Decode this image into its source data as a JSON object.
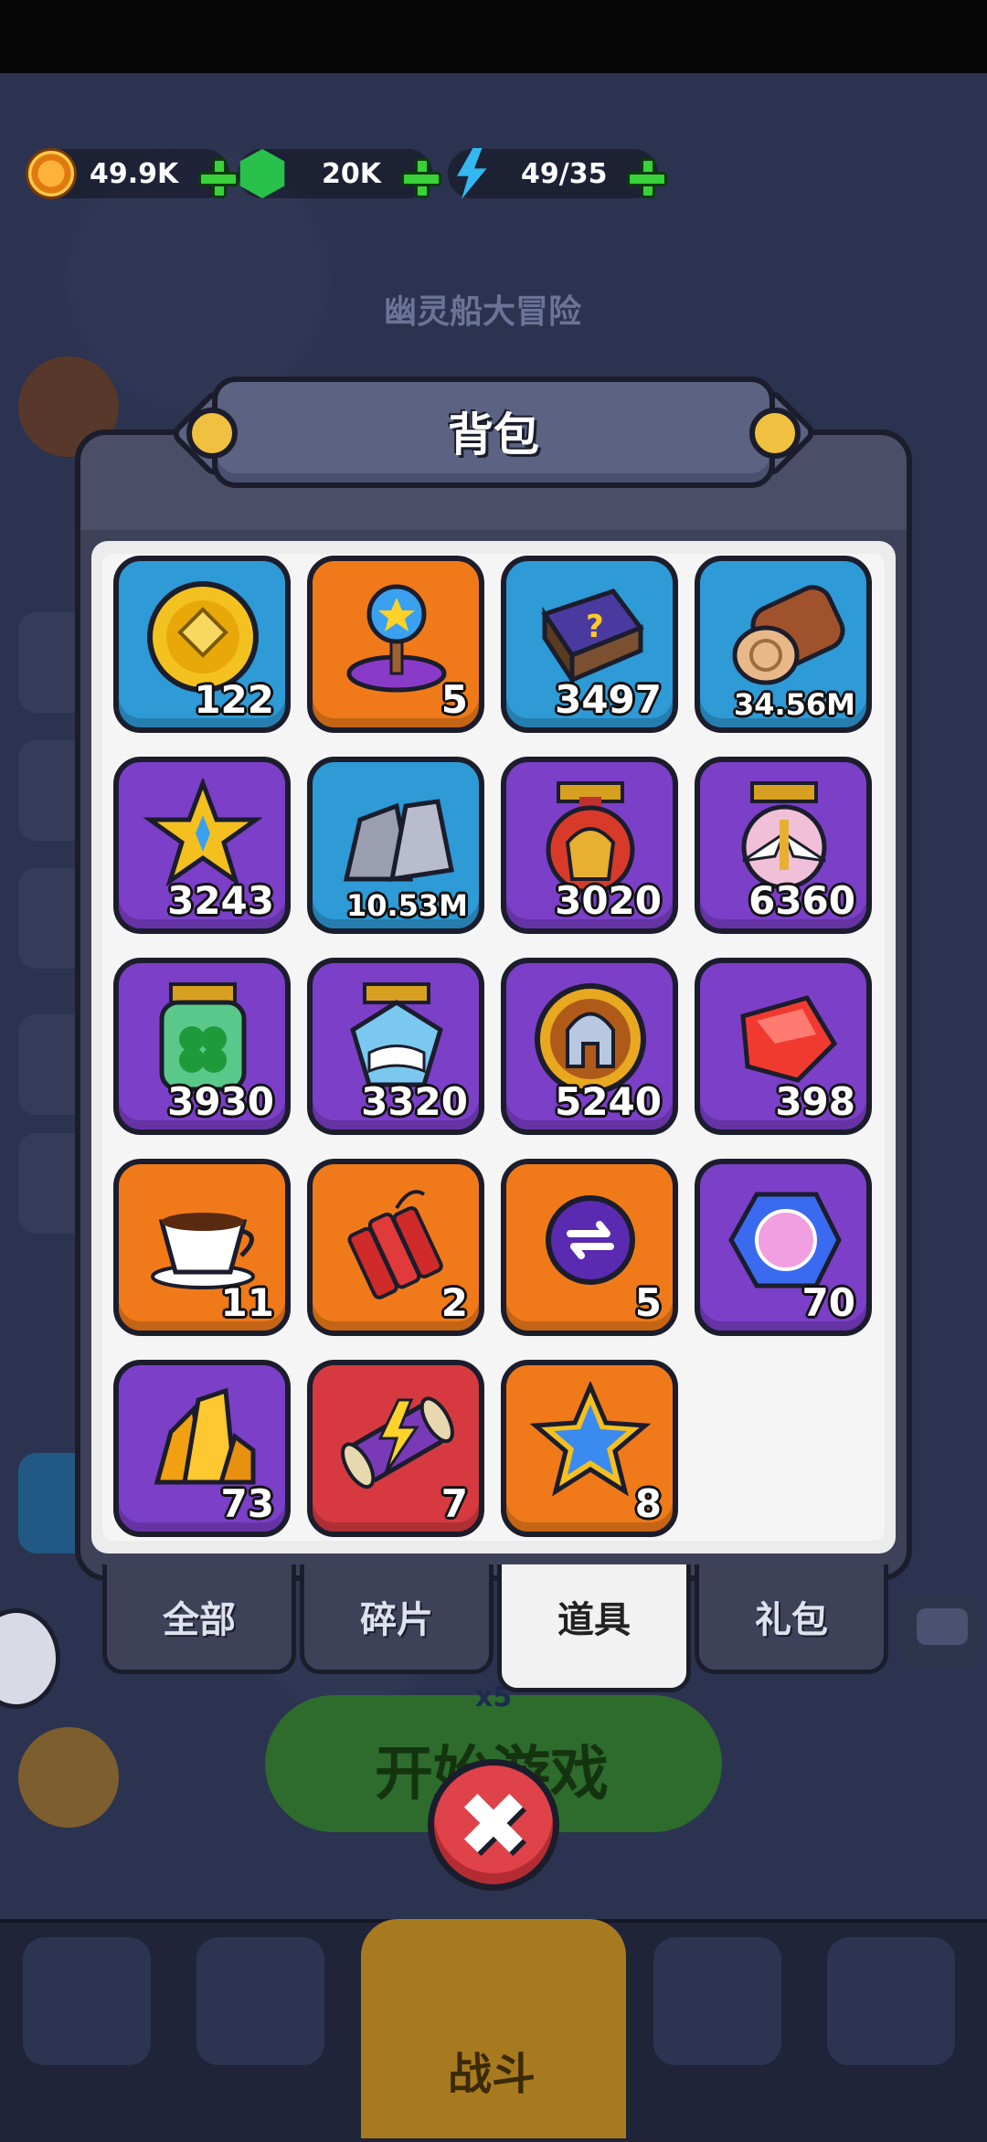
{
  "currency": {
    "gold": "49.9K",
    "gems": "20K",
    "energy": "49/35"
  },
  "background": {
    "event_title": "幽灵船大冒险",
    "start_button": "开始游戏",
    "energy_cost": "x5",
    "nav_fight": "战斗"
  },
  "modal": {
    "title": "背包",
    "items": [
      {
        "name": "gold-token",
        "count": "122",
        "color": "blue"
      },
      {
        "name": "star-pin",
        "count": "5",
        "color": "orange"
      },
      {
        "name": "mystery-book",
        "count": "3497",
        "color": "blue"
      },
      {
        "name": "wood-log",
        "count": "34.56M",
        "color": "blue"
      },
      {
        "name": "star-badge",
        "count": "3243",
        "color": "purple"
      },
      {
        "name": "stone-ore",
        "count": "10.53M",
        "color": "blue"
      },
      {
        "name": "spartan-medal",
        "count": "3020",
        "color": "purple"
      },
      {
        "name": "angel-medal",
        "count": "6360",
        "color": "purple"
      },
      {
        "name": "clover-jar",
        "count": "3930",
        "color": "purple"
      },
      {
        "name": "book-medal",
        "count": "3320",
        "color": "purple"
      },
      {
        "name": "helmet-coin",
        "count": "5240",
        "color": "purple"
      },
      {
        "name": "red-gem",
        "count": "398",
        "color": "purple"
      },
      {
        "name": "tea-cup",
        "count": "11",
        "color": "orange"
      },
      {
        "name": "dynamite",
        "count": "2",
        "color": "orange"
      },
      {
        "name": "refresh-token",
        "count": "5",
        "color": "orange"
      },
      {
        "name": "crystal-orb",
        "count": "70",
        "color": "purple"
      },
      {
        "name": "gold-crystal",
        "count": "73",
        "color": "purple"
      },
      {
        "name": "lightning-scroll",
        "count": "7",
        "color": "red"
      },
      {
        "name": "blue-star",
        "count": "8",
        "color": "orange"
      }
    ],
    "tabs": [
      {
        "label": "全部"
      },
      {
        "label": "碎片"
      },
      {
        "label": "道具"
      },
      {
        "label": "礼包"
      }
    ],
    "active_tab": "道具"
  }
}
